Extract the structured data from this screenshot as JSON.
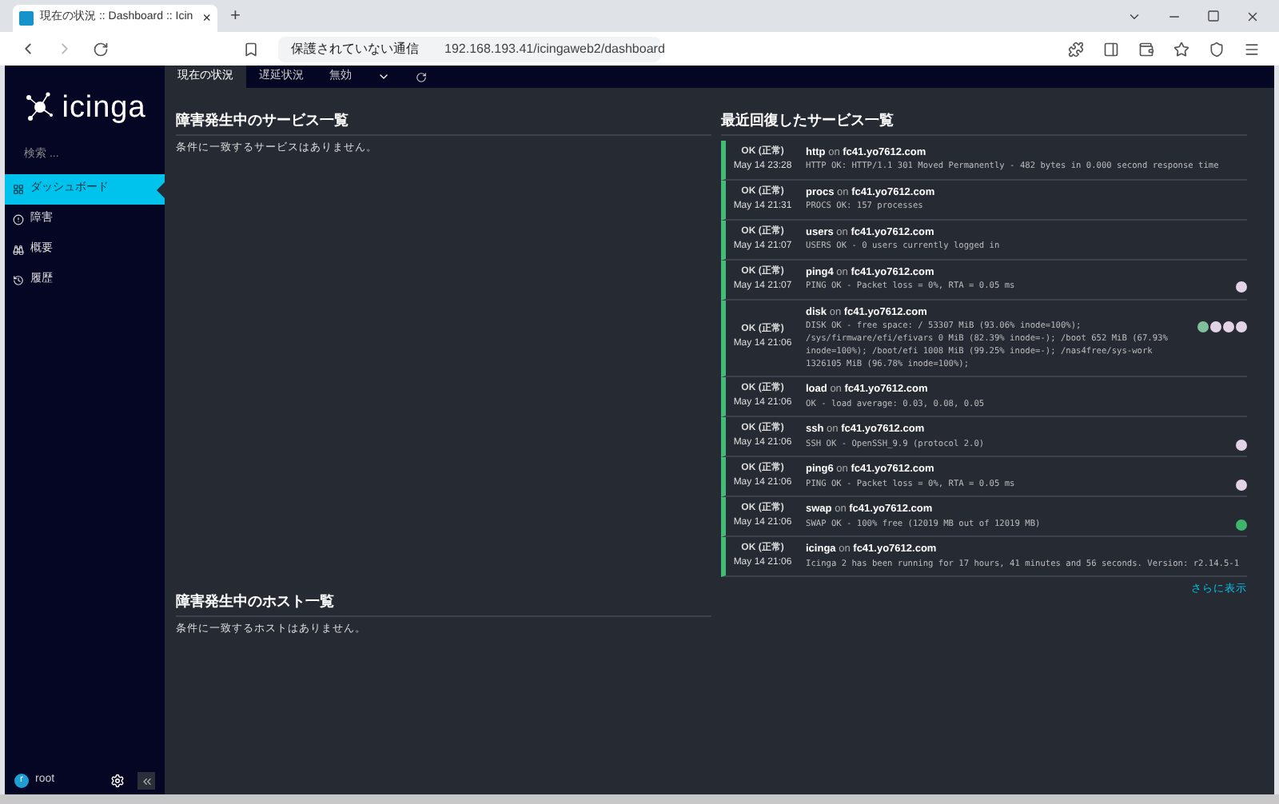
{
  "browser": {
    "tab_title": "現在の状況 :: Dashboard :: Icin",
    "tab_close": "×",
    "new_tab": "+",
    "security_label": "保護されていない通信",
    "url": "192.168.193.41/icingaweb2/dashboard"
  },
  "sidebar": {
    "logo": "icinga",
    "search": {
      "placeholder": "検索 ..."
    },
    "items": [
      {
        "label": "ダッシュボード",
        "selected": true
      },
      {
        "label": "障害",
        "selected": false
      },
      {
        "label": "概要",
        "selected": false
      },
      {
        "label": "履歴",
        "selected": false
      }
    ],
    "user": {
      "initial": "r",
      "name": "root"
    }
  },
  "tabs": [
    {
      "label": "現在の状況",
      "selected": true
    },
    {
      "label": "遅延状況",
      "selected": false
    },
    {
      "label": "無効",
      "selected": false
    }
  ],
  "left_panels": [
    {
      "title": "障害発生中のサービス一覧",
      "message": "条件に一致するサービスはありません。"
    },
    {
      "title": "障害発生中のホスト一覧",
      "message": "条件に一致するホストはありません。"
    }
  ],
  "recent": {
    "title": "最近回復したサービス一覧",
    "more_link": "さらに表示",
    "services": [
      {
        "state": "OK (正常)",
        "time": "May 14 23:28",
        "service": "http",
        "on": "on",
        "host": "fc41.yo7612.com",
        "output": "HTTP OK: HTTP/1.1 301 Moved Permanently - 482 bytes in 0.000 second response time"
      },
      {
        "state": "OK (正常)",
        "time": "May 14 21:31",
        "service": "procs",
        "on": "on",
        "host": "fc41.yo7612.com",
        "output": "PROCS OK: 157 processes"
      },
      {
        "state": "OK (正常)",
        "time": "May 14 21:07",
        "service": "users",
        "on": "on",
        "host": "fc41.yo7612.com",
        "output": "USERS OK - 0 users currently logged in"
      },
      {
        "state": "OK (正常)",
        "time": "May 14 21:07",
        "service": "ping4",
        "on": "on",
        "host": "fc41.yo7612.com",
        "output": "PING OK - Packet loss = 0%, RTA = 0.05 ms",
        "pies": [
          {
            "color": "#e3d3e6"
          }
        ]
      },
      {
        "state": "OK (正常)",
        "time": "May 14 21:06",
        "service": "disk",
        "on": "on",
        "host": "fc41.yo7612.com",
        "output": "DISK OK - free space: / 53307 MiB (93.06% inode=100%); /sys/firmware/efi/efivars 0 MiB (82.39% inode=-); /boot 652 MiB (67.93% inode=100%); /boot/efi 1008 MiB (99.25% inode=-); /nas4free/sys-work 1326105 MiB (96.78% inode=100%);",
        "pies": [
          {
            "color": "#7fbf9a"
          },
          {
            "color": "#e3d3e6"
          },
          {
            "color": "#e3d3e6"
          },
          {
            "color": "#e3d3e6"
          }
        ]
      },
      {
        "state": "OK (正常)",
        "time": "May 14 21:06",
        "service": "load",
        "on": "on",
        "host": "fc41.yo7612.com",
        "output": "OK - load average: 0.03, 0.08, 0.05"
      },
      {
        "state": "OK (正常)",
        "time": "May 14 21:06",
        "service": "ssh",
        "on": "on",
        "host": "fc41.yo7612.com",
        "output": "SSH OK - OpenSSH_9.9 (protocol 2.0)",
        "pies": [
          {
            "color": "#e3d3e6"
          }
        ]
      },
      {
        "state": "OK (正常)",
        "time": "May 14 21:06",
        "service": "ping6",
        "on": "on",
        "host": "fc41.yo7612.com",
        "output": "PING OK - Packet loss = 0%, RTA = 0.05 ms",
        "pies": [
          {
            "color": "#e3d3e6"
          }
        ]
      },
      {
        "state": "OK (正常)",
        "time": "May 14 21:06",
        "service": "swap",
        "on": "on",
        "host": "fc41.yo7612.com",
        "output": "SWAP OK - 100% free (12019 MB out of 12019 MB)",
        "pies": [
          {
            "color": "#3fb56b"
          }
        ]
      },
      {
        "state": "OK (正常)",
        "time": "May 14 21:06",
        "service": "icinga",
        "on": "on",
        "host": "fc41.yo7612.com",
        "output": "Icinga 2 has been running for 17 hours, 41 minutes and 56 seconds. Version: r2.14.5-1"
      }
    ]
  }
}
